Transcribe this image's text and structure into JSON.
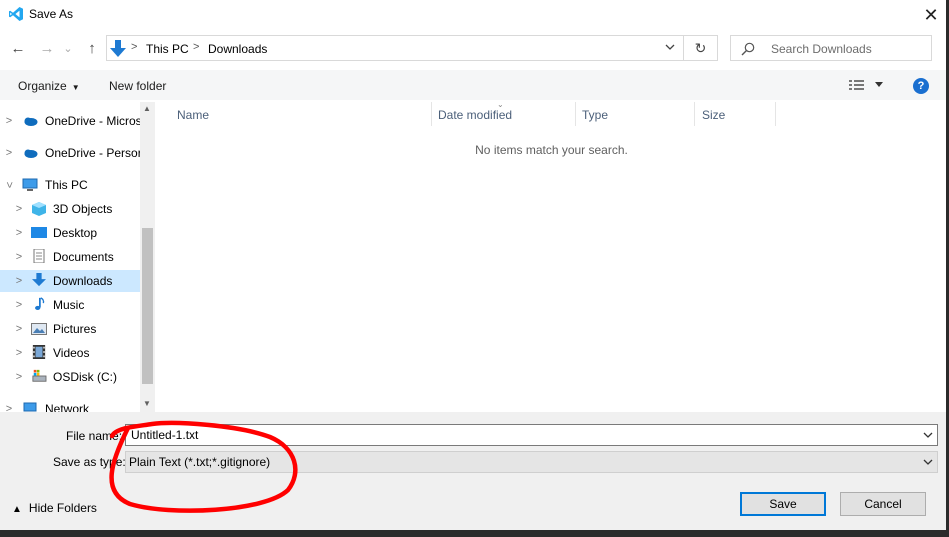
{
  "window": {
    "title": "Save As",
    "close_glyph": "✕"
  },
  "nav": {
    "back_glyph": "←",
    "forward_glyph": "→",
    "recent_glyph": "⌄",
    "up_glyph": "↑",
    "refresh_glyph": "↻",
    "breadcrumbs": [
      "This PC",
      "Downloads"
    ],
    "search_placeholder": "Search Downloads"
  },
  "toolbar": {
    "organize": "Organize",
    "new_folder": "New folder",
    "help": "?"
  },
  "sidebar": {
    "items": [
      {
        "label": "OneDrive - Micros",
        "icon": "onedrive-icon"
      },
      {
        "label": "OneDrive - Persor",
        "icon": "onedrive-icon"
      },
      {
        "label": "This PC",
        "icon": "computer-icon"
      },
      {
        "label": "3D Objects",
        "icon": "cube-icon"
      },
      {
        "label": "Desktop",
        "icon": "desktop-icon"
      },
      {
        "label": "Documents",
        "icon": "document-icon"
      },
      {
        "label": "Downloads",
        "icon": "download-icon",
        "selected": true
      },
      {
        "label": "Music",
        "icon": "music-icon"
      },
      {
        "label": "Pictures",
        "icon": "pictures-icon"
      },
      {
        "label": "Videos",
        "icon": "video-icon"
      },
      {
        "label": "OSDisk (C:)",
        "icon": "disk-icon"
      },
      {
        "label": "Network",
        "icon": "network-icon"
      }
    ]
  },
  "content": {
    "columns": [
      "Name",
      "Date modified",
      "Type",
      "Size"
    ],
    "empty_message": "No items match your search."
  },
  "form": {
    "file_name_label": "File name:",
    "file_name_value": "Untitled-1.txt",
    "save_type_label": "Save as type:",
    "save_type_value": "Plain Text (*.txt;*.gitignore)"
  },
  "footer": {
    "hide_folders": "Hide Folders",
    "save": "Save",
    "cancel": "Cancel"
  },
  "colors": {
    "accent": "#0078d7",
    "selection": "#cce8ff",
    "annotation": "#ff0000"
  }
}
